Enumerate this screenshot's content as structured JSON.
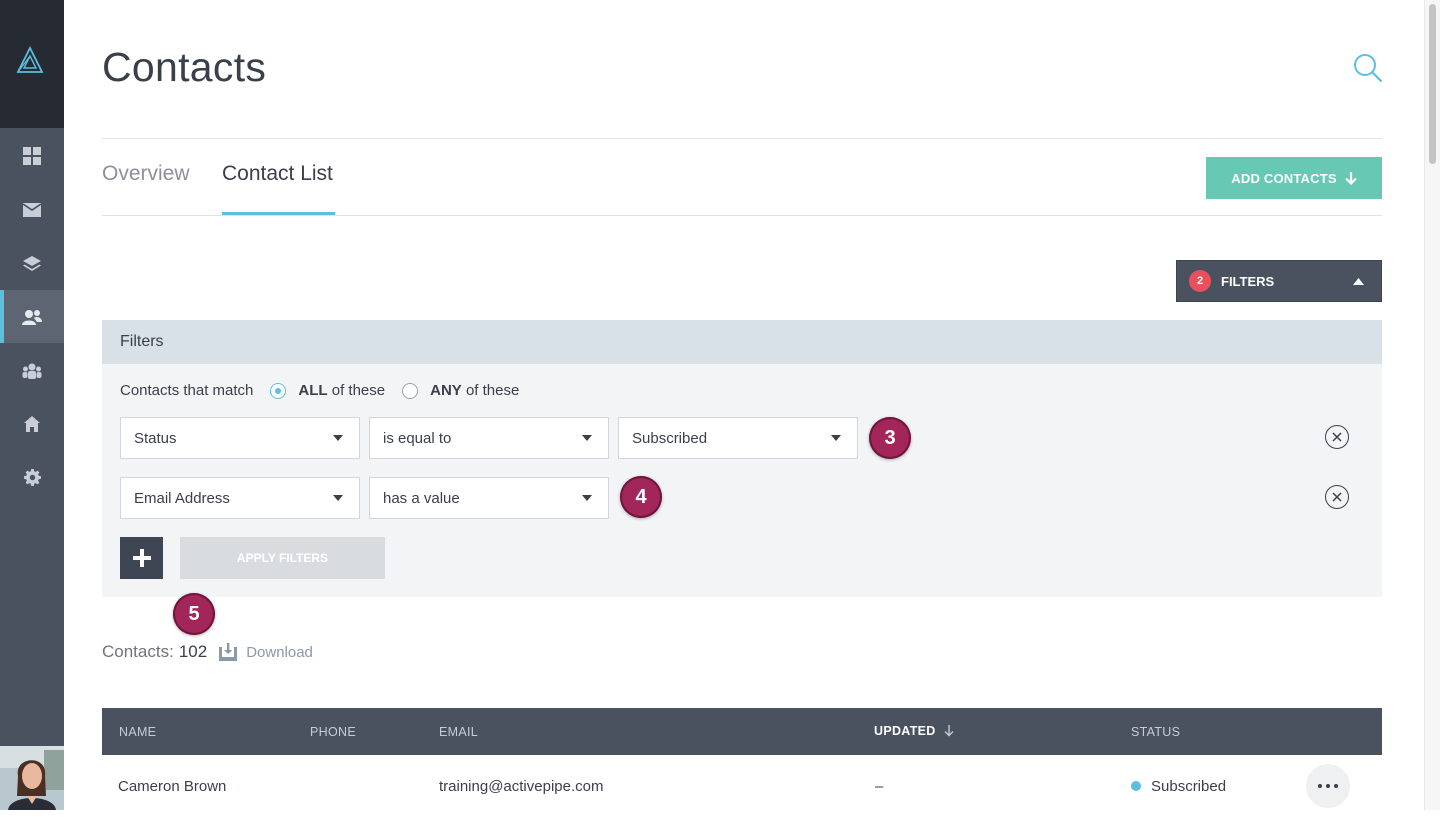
{
  "page": {
    "title": "Contacts"
  },
  "tabs": [
    {
      "label": "Overview",
      "active": false
    },
    {
      "label": "Contact List",
      "active": true
    }
  ],
  "actions": {
    "add_contacts": "ADD CONTACTS"
  },
  "filters_toggle": {
    "count": "2",
    "label": "FILTERS"
  },
  "filter_panel": {
    "title": "Filters",
    "match_prefix": "Contacts that match",
    "match_all_bold": "ALL",
    "match_all_rest": " of these",
    "match_any_bold": "ANY",
    "match_any_rest": " of these",
    "selected_match": "ALL",
    "rows": [
      {
        "field": "Status",
        "operator": "is equal to",
        "value": "Subscribed"
      },
      {
        "field": "Email Address",
        "operator": "has a value"
      }
    ],
    "apply_label": "APPLY FILTERS"
  },
  "steps": [
    "3",
    "4",
    "5"
  ],
  "summary": {
    "label": "Contacts:",
    "count": "102",
    "download": "Download"
  },
  "table": {
    "columns": [
      "NAME",
      "PHONE",
      "EMAIL",
      "UPDATED",
      "STATUS"
    ],
    "sorted_column": "UPDATED",
    "rows": [
      {
        "name": "Cameron Brown",
        "phone": "",
        "email": "training@activepipe.com",
        "updated": "–",
        "status": "Subscribed"
      }
    ]
  },
  "colors": {
    "accent": "#5bc0de",
    "add_button": "#67c9b4",
    "sidebar": "#4a5260",
    "badge": "#e9505b",
    "step_marker": "#a3265b"
  },
  "icons": {
    "logo": "triangle-logo-icon",
    "nav": [
      "dashboard-icon",
      "mail-icon",
      "layers-icon",
      "contacts-icon",
      "groups-icon",
      "home-icon",
      "settings-icon"
    ],
    "search": "search-icon",
    "download": "download-icon"
  }
}
